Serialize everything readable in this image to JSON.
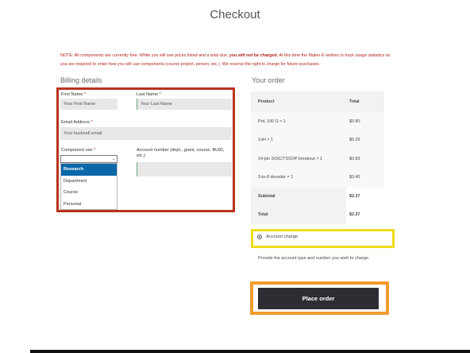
{
  "page": {
    "title": "Checkout"
  },
  "note": {
    "part1": "NOTE: All components are currently free.  While you will see prices listed and a total due, ",
    "bold": "you will not be charged.",
    "part2": "  At this time the Maker-E wishes to track usage statistics so you are required to enter how you will use components (course project, person, etc.).  We reserve the right to charge for future purchases."
  },
  "billing": {
    "title": "Billing details",
    "first_name_label": "First Name",
    "first_name_placeholder": "Your First Name",
    "last_name_label": "Last Name",
    "last_name_placeholder": "Your Last Name",
    "email_label": "Email Address",
    "email_placeholder": "Your bucknell email",
    "component_use_label": "Component use",
    "required_mark": "*",
    "component_use_options": [
      "Research",
      "Department",
      "Course",
      "Personal"
    ],
    "select_arrow": "⌄",
    "account_number_label": "Account number (dept., grant, course, BUID, etc.)"
  },
  "order": {
    "title": "Your order",
    "col_product": "Product",
    "col_total": "Total",
    "items": [
      {
        "name": "Pot, 100 Ω  × 1",
        "total": "$0.80"
      },
      {
        "name": "1uH  × 1",
        "total": "$0.29"
      },
      {
        "name": "14-pin SOIC/TSSOP breakout  × 1",
        "total": "$0.83"
      },
      {
        "name": "3-to-8 decoder  × 1",
        "total": "$0.45"
      }
    ],
    "subtotal_label": "Subtotal",
    "subtotal_value": "$2.37",
    "total_label": "Total",
    "total_value": "$2.37"
  },
  "payment": {
    "method_label": "Account charge",
    "description": "Provide the account type and number you wish to charge.",
    "place_order_label": "Place order"
  },
  "colors": {
    "highlight_red": "#b8331d",
    "highlight_yellow": "#f0dc1c",
    "highlight_orange": "#f29b2e",
    "button_dark": "#2c2d33",
    "selected_blue": "#0a68a9"
  }
}
